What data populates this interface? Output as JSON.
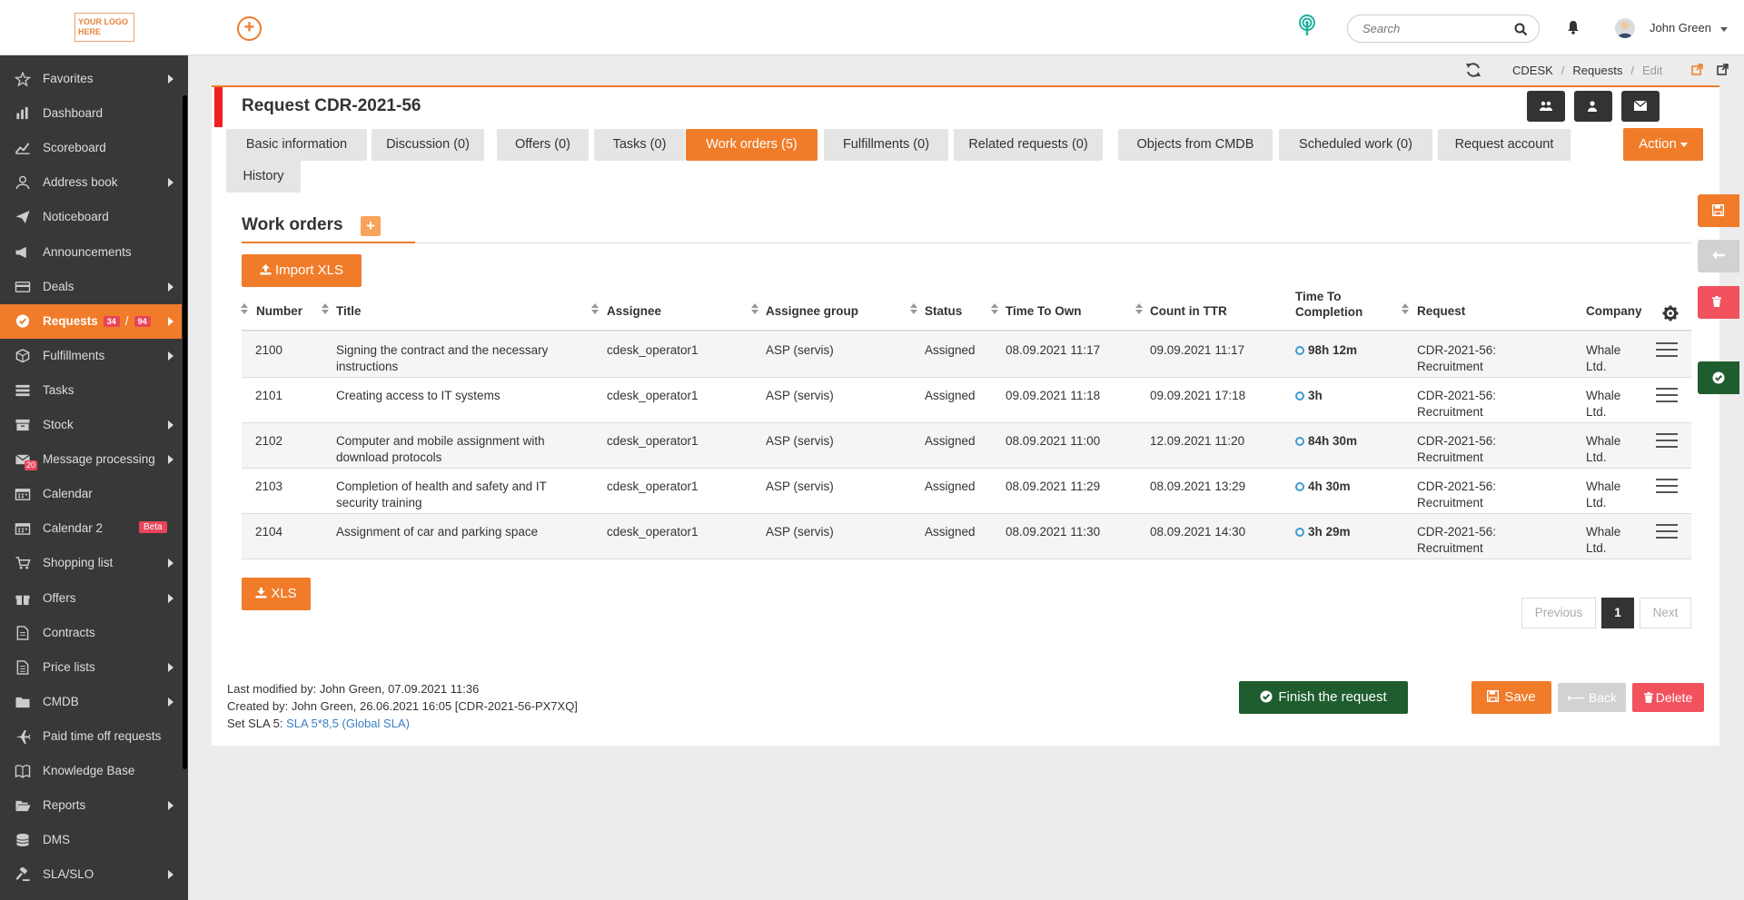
{
  "topbar": {
    "logo_text_1": "YOUR LOGO",
    "logo_text_2": "HERE",
    "add_glyph": "+",
    "search_placeholder": "Search",
    "user_name": "John Green"
  },
  "sidebar": {
    "items": [
      {
        "label": "Favorites",
        "icon": "star-icon",
        "arrow": true
      },
      {
        "label": "Dashboard",
        "icon": "bar-chart-icon",
        "arrow": false
      },
      {
        "label": "Scoreboard",
        "icon": "line-chart-icon",
        "arrow": false
      },
      {
        "label": "Address book",
        "icon": "user-icon",
        "arrow": true
      },
      {
        "label": "Noticeboard",
        "icon": "paper-plane-icon",
        "arrow": false
      },
      {
        "label": "Announcements",
        "icon": "megaphone-icon",
        "arrow": false
      },
      {
        "label": "Deals",
        "icon": "credit-card-icon",
        "arrow": true
      },
      {
        "label": "Requests",
        "icon": "check-circle-icon",
        "arrow": true,
        "badge_a": "34",
        "sep": "/",
        "badge_b": "94"
      },
      {
        "label": "Fulfillments",
        "icon": "cube-icon",
        "arrow": true
      },
      {
        "label": "Tasks",
        "icon": "tasks-icon",
        "arrow": false
      },
      {
        "label": "Stock",
        "icon": "archive-icon",
        "arrow": true
      },
      {
        "label": "Message processing",
        "icon": "envelope-icon",
        "arrow": true,
        "badge": "20"
      },
      {
        "label": "Calendar",
        "icon": "calendar-icon",
        "arrow": false
      },
      {
        "label": "Calendar 2",
        "icon": "calendar-icon",
        "arrow": false,
        "beta": "Beta"
      },
      {
        "label": "Shopping list",
        "icon": "cart-icon",
        "arrow": true
      },
      {
        "label": "Offers",
        "icon": "gift-icon",
        "arrow": true
      },
      {
        "label": "Contracts",
        "icon": "file-icon",
        "arrow": false
      },
      {
        "label": "Price lists",
        "icon": "list-file-icon",
        "arrow": true
      },
      {
        "label": "CMDB",
        "icon": "folder-icon",
        "arrow": true
      },
      {
        "label": "Paid time off requests",
        "icon": "plane-icon",
        "arrow": false
      },
      {
        "label": "Knowledge Base",
        "icon": "book-icon",
        "arrow": false
      },
      {
        "label": "Reports",
        "icon": "folder-open-icon",
        "arrow": true
      },
      {
        "label": "DMS",
        "icon": "database-icon",
        "arrow": false
      },
      {
        "label": "SLA/SLO",
        "icon": "gavel-icon",
        "arrow": true
      }
    ]
  },
  "breadcrumb": {
    "items": [
      "CDESK",
      "Requests",
      "Edit"
    ]
  },
  "request": {
    "title": "Request CDR-2021-56"
  },
  "tabs": [
    {
      "label": "Basic information"
    },
    {
      "label": "Discussion (0)"
    },
    {
      "label": "Offers (0)"
    },
    {
      "label": "Tasks (0)"
    },
    {
      "label": "Work orders (5)",
      "active": true
    },
    {
      "label": "Fulfillments (0)"
    },
    {
      "label": "Related requests (0)"
    },
    {
      "label": "Objects from CMDB"
    },
    {
      "label": "Scheduled work (0)"
    },
    {
      "label": "Request account"
    },
    {
      "label": "History"
    }
  ],
  "action_label": "Action",
  "section": {
    "title": "Work orders",
    "plus": "+"
  },
  "import_label": "Import XLS",
  "xls_label": "XLS",
  "table": {
    "headers": {
      "number": "Number",
      "title": "Title",
      "assignee": "Assignee",
      "group": "Assignee group",
      "status": "Status",
      "tto": "Time To Own",
      "count": "Count in TTR",
      "ttc_1": "Time To",
      "ttc_2": "Completion",
      "request": "Request",
      "company": "Company"
    },
    "rows": [
      {
        "number": "2100",
        "title_1": "Signing the contract and the necessary",
        "title_2": "instructions",
        "assignee": "cdesk_operator1",
        "group": "ASP (servis)",
        "status": "Assigned",
        "tto": "08.09.2021 11:17",
        "count": "09.09.2021 11:17",
        "ttc": "98h 12m",
        "request_1": "CDR-2021-56:",
        "request_2": "Recruitment",
        "company_1": "Whale",
        "company_2": "Ltd."
      },
      {
        "number": "2101",
        "title_1": "Creating access to IT systems",
        "title_2": "",
        "assignee": "cdesk_operator1",
        "group": "ASP (servis)",
        "status": "Assigned",
        "tto": "09.09.2021 11:18",
        "count": "09.09.2021 17:18",
        "ttc": "3h",
        "request_1": "CDR-2021-56:",
        "request_2": "Recruitment",
        "company_1": "Whale",
        "company_2": "Ltd."
      },
      {
        "number": "2102",
        "title_1": "Computer and mobile assignment with",
        "title_2": "download protocols",
        "assignee": "cdesk_operator1",
        "group": "ASP (servis)",
        "status": "Assigned",
        "tto": "08.09.2021 11:00",
        "count": "12.09.2021 11:20",
        "ttc": "84h 30m",
        "request_1": "CDR-2021-56:",
        "request_2": "Recruitment",
        "company_1": "Whale",
        "company_2": "Ltd."
      },
      {
        "number": "2103",
        "title_1": "Completion of health and safety and IT",
        "title_2": "security training",
        "assignee": "cdesk_operator1",
        "group": "ASP (servis)",
        "status": "Assigned",
        "tto": "08.09.2021 11:29",
        "count": "08.09.2021 13:29",
        "ttc": "4h 30m",
        "request_1": "CDR-2021-56:",
        "request_2": "Recruitment",
        "company_1": "Whale",
        "company_2": "Ltd."
      },
      {
        "number": "2104",
        "title_1": "Assignment of car and parking space",
        "title_2": "",
        "assignee": "cdesk_operator1",
        "group": "ASP (servis)",
        "status": "Assigned",
        "tto": "08.09.2021 11:30",
        "count": "08.09.2021 14:30",
        "ttc": "3h 29m",
        "request_1": "CDR-2021-56:",
        "request_2": "Recruitment",
        "company_1": "Whale",
        "company_2": "Ltd."
      }
    ]
  },
  "pager": {
    "previous": "Previous",
    "current": "1",
    "next": "Next"
  },
  "meta": {
    "modified_label": "Last modified by:",
    "modified_value": "John Green,  07.09.2021 11:36",
    "created_label": "Created by:",
    "created_value": "John Green,  26.06.2021 16:05 [CDR-2021-56-PX7XQ]",
    "sla_label": "Set SLA 5:",
    "sla_value": "SLA 5*8,5 (Global SLA)"
  },
  "footer": {
    "finish_label": "Finish the request",
    "save_label": "Save",
    "back_label": "Back",
    "delete_label": "Delete"
  },
  "colors": {
    "accent": "#f07c2a",
    "sidebar": "#383838",
    "finish": "#1f5d2f",
    "danger": "#f2525e",
    "link": "#3a7fc0"
  }
}
